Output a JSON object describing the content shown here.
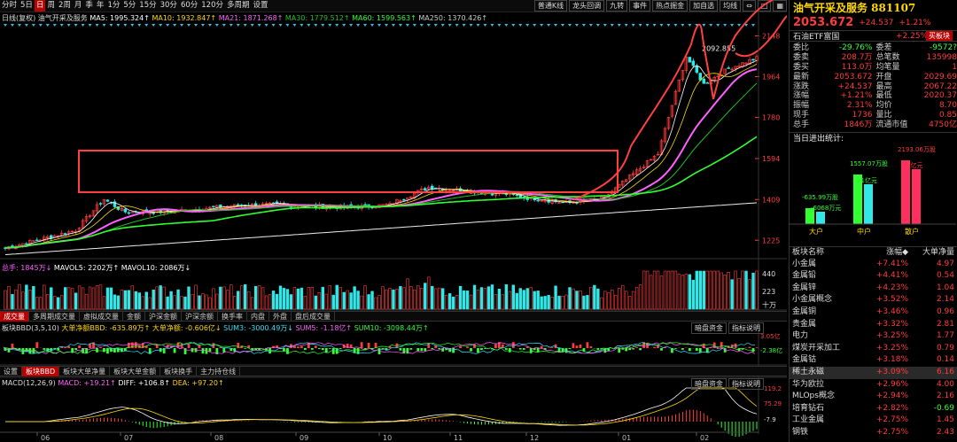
{
  "toolbar": {
    "periods": [
      "分时",
      "5日",
      "日",
      "周",
      "2周",
      "月",
      "季",
      "年",
      "1分",
      "5分",
      "15分",
      "30分",
      "60分",
      "120分",
      "多周期",
      "设置"
    ],
    "active_period": "日",
    "right_buttons": [
      "普通K线",
      "龙头回调",
      "九转",
      "事件",
      "热点掘金",
      "加自选",
      "均线"
    ],
    "icons": [
      "scale-icon",
      "square-icon",
      "grid-icon"
    ]
  },
  "legend": {
    "label": "日线(复权) 油气开采及服务",
    "ma5": "MA5: 1995.324↑",
    "ma10": "MA10: 1932.847↑",
    "ma21": "MA21: 1871.268↑",
    "ma30": "MA30: 1779.512↑",
    "ma60": "MA60: 1599.563↑",
    "ma250": "MA250: 1370.426↑"
  },
  "price_axis": [
    "2148",
    "1964",
    "1780",
    "1594",
    "1409",
    "1225"
  ],
  "high_label": "2092.855",
  "volume": {
    "legend_total": "总手: 1845万↓",
    "ma5": "MAVOL5: 2202万↑",
    "ma10": "MAVOL10: 2086万↓",
    "axis": [
      "440",
      "223",
      "十万"
    ]
  },
  "tabs1": [
    "成交量",
    "多周期成交量",
    "虚拟成交量",
    "金额",
    "沪深金额",
    "沪深余额",
    "换手率",
    "内盘",
    "外盘",
    "盘后成交量"
  ],
  "active_tab1": "成交量",
  "bbd": {
    "legend": "板块BBD(3,5,10)",
    "net": "大单净额BBD: -635.89万↑",
    "net2": "大单净额: -0.606亿↓",
    "sum3": "SUM3: -3000.49万↓",
    "sum5": "SUM5: -1.18亿↑",
    "sum10": "SUM10: -3098.44万↑",
    "axis": [
      "3.05亿",
      "-2.38亿"
    ],
    "btns": [
      "暗盘资金",
      "指标说明"
    ]
  },
  "tabs2": [
    "设置",
    "板块BBD",
    "板块大单净量",
    "板块大单金额",
    "板块换手",
    "主力持仓线"
  ],
  "active_tab2": "板块BBD",
  "macd": {
    "label": "MACD(12,26,9)",
    "macd": "MACD: +19.21↑",
    "diff": "DIFF: +106.8↑",
    "dea": "DEA: +97.20↑",
    "axis": [
      "119.2",
      "75.29",
      "-7.9"
    ],
    "btns": [
      "暗盘资金",
      "指标说明"
    ]
  },
  "x_ticks": [
    "06",
    "07",
    "08",
    "09",
    "10",
    "11",
    "12",
    "01",
    "02"
  ],
  "quote": {
    "name": "油气开采及服务 881107",
    "price": "2053.672",
    "change": "+24.537",
    "pct": "+1.21%",
    "etf": "石油ETF富国",
    "etf_pct": "+2.25%",
    "buy_btn": "买板块",
    "rows": [
      [
        "委比",
        "-29.76%",
        "委差",
        "-9572?"
      ],
      [
        "委卖",
        "208.7万",
        "总笔数",
        "135998"
      ],
      [
        "委买",
        "113.0万",
        "均笔量",
        "1"
      ],
      [
        "最新",
        "2053.672",
        "开盘",
        "2029.69"
      ],
      [
        "涨跌",
        "+24.537",
        "最高",
        "2067.22"
      ],
      [
        "涨幅",
        "+1.21%",
        "最低",
        "2020.37"
      ],
      [
        "振幅",
        "2.31%",
        "均价",
        "8.70"
      ],
      [
        "现手",
        "1736",
        "量比",
        "0.85"
      ],
      [
        "总手",
        "1846万",
        "流通市值",
        "4750亿"
      ]
    ]
  },
  "flow": {
    "title": "当日进出统计:",
    "bars": [
      {
        "cat": "大户",
        "in": "-635.99万股",
        "out": "-6068万元"
      },
      {
        "cat": "中户",
        "in": "1557.07万股",
        "out": "-1亿元"
      },
      {
        "cat": "散户",
        "in": "2193.06万股",
        "out": "2亿元"
      }
    ]
  },
  "board_header": [
    "板块名称",
    "涨幅◆",
    "大单净量"
  ],
  "boards": [
    [
      "小金属",
      "+7.41%",
      "4.97"
    ],
    [
      "金属铅",
      "+4.41%",
      "0.54"
    ],
    [
      "金属锌",
      "+4.23%",
      "1.04"
    ],
    [
      "小金属概念",
      "+3.52%",
      "2.14"
    ],
    [
      "金属铜",
      "+3.46%",
      "0.96"
    ],
    [
      "贵金属",
      "+3.32%",
      "2.81"
    ],
    [
      "电力",
      "+3.25%",
      "1.77"
    ],
    [
      "煤炭开采加工",
      "+3.25%",
      "0.79"
    ],
    [
      "金属钴",
      "+3.18%",
      "0.14"
    ],
    [
      "稀土永磁",
      "+3.09%",
      "6.16"
    ],
    [
      "华为欧拉",
      "+2.96%",
      "4.00"
    ],
    [
      "MLOps概念",
      "+2.94%",
      "2.16"
    ],
    [
      "培育钻石",
      "+2.82%",
      "-0.69"
    ],
    [
      "工业金属",
      "+2.75%",
      "1.45"
    ],
    [
      "钢铁",
      "+2.75%",
      "2.43"
    ]
  ],
  "colors": {
    "up": "#ff3c3c",
    "down": "#30e8e8",
    "ma5": "#ffffff",
    "ma10": "#ffd800",
    "ma21": "#ff60ff",
    "ma30": "#20c020",
    "ma60": "#30ff30",
    "ma250": "#eeeeee",
    "annot": "#ff4040"
  }
}
